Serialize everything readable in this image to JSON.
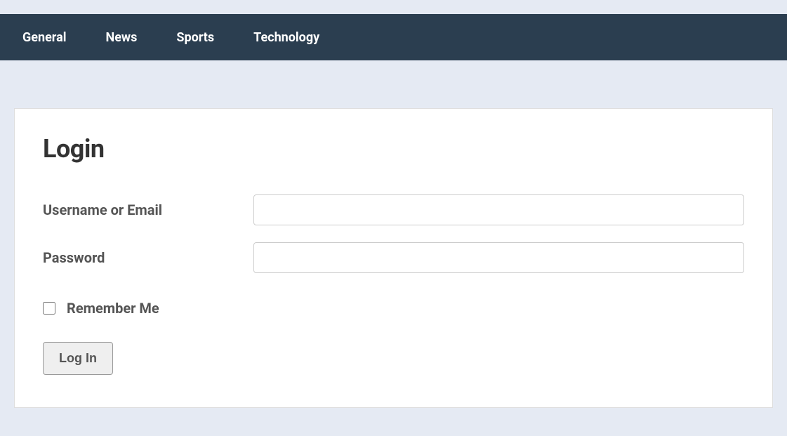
{
  "nav": {
    "items": [
      {
        "label": "General"
      },
      {
        "label": "News"
      },
      {
        "label": "Sports"
      },
      {
        "label": "Technology"
      }
    ]
  },
  "login": {
    "title": "Login",
    "username_label": "Username or Email",
    "username_value": "",
    "password_label": "Password",
    "password_value": "",
    "remember_label": "Remember Me",
    "submit_label": "Log In"
  }
}
